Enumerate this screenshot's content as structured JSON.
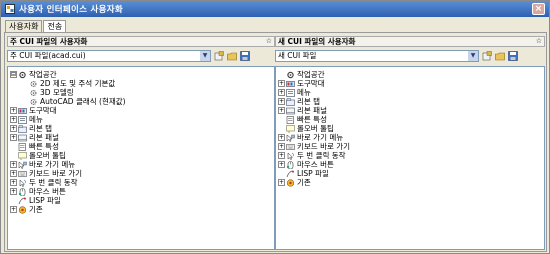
{
  "window": {
    "title": "사용자 인터페이스 사용자화",
    "close_label": "×"
  },
  "tabs": [
    {
      "label": "사용자화"
    },
    {
      "label": "전송"
    }
  ],
  "left_panel": {
    "header": "주 CUI 파일의 사용자화",
    "collapse": "☆",
    "selected_file": "주 CUI 파일(acad.cui)",
    "tree": [
      {
        "label": "작업공간",
        "icon": "workspace-icon",
        "indent": 0,
        "expander": "⊟"
      },
      {
        "label": "2D 제도 및 주석 기본값",
        "icon": "gear-icon",
        "indent": 1,
        "expander": ""
      },
      {
        "label": "3D 모델링",
        "icon": "gear-icon",
        "indent": 1,
        "expander": ""
      },
      {
        "label": "AutoCAD 클래식 (현재값)",
        "icon": "gear-icon",
        "indent": 1,
        "expander": ""
      },
      {
        "label": "도구막대",
        "icon": "toolbar-icon",
        "indent": 0,
        "expander": "+"
      },
      {
        "label": "메뉴",
        "icon": "menu-icon",
        "indent": 0,
        "expander": "+"
      },
      {
        "label": "리본 탭",
        "icon": "ribbon-tab-icon",
        "indent": 0,
        "expander": "+"
      },
      {
        "label": "리본 패널",
        "icon": "ribbon-panel-icon",
        "indent": 0,
        "expander": "+"
      },
      {
        "label": "빠른 특성",
        "icon": "quick-props-icon",
        "indent": 0,
        "expander": ""
      },
      {
        "label": "롤오버 툴팁",
        "icon": "tooltip-icon",
        "indent": 0,
        "expander": ""
      },
      {
        "label": "바로 가기 메뉴",
        "icon": "shortcut-menu-icon",
        "indent": 0,
        "expander": "+"
      },
      {
        "label": "키보드 바로 가기",
        "icon": "keyboard-icon",
        "indent": 0,
        "expander": "+"
      },
      {
        "label": "두 번 클릭 동작",
        "icon": "double-click-icon",
        "indent": 0,
        "expander": "+"
      },
      {
        "label": "마우스 버튼",
        "icon": "mouse-icon",
        "indent": 0,
        "expander": "+"
      },
      {
        "label": "LISP 파일",
        "icon": "lisp-icon",
        "indent": 0,
        "expander": ""
      },
      {
        "label": "기존",
        "icon": "legacy-icon",
        "indent": 0,
        "expander": "+"
      }
    ]
  },
  "right_panel": {
    "header": "새 CUI 파일의 사용자화",
    "collapse": "☆",
    "selected_file": "새 CUI 파일",
    "tree": [
      {
        "label": "작업공간",
        "icon": "workspace-icon",
        "indent": 0,
        "expander": ""
      },
      {
        "label": "도구막대",
        "icon": "toolbar-icon",
        "indent": 0,
        "expander": "+"
      },
      {
        "label": "메뉴",
        "icon": "menu-icon",
        "indent": 0,
        "expander": "+"
      },
      {
        "label": "리본 탭",
        "icon": "ribbon-tab-icon",
        "indent": 0,
        "expander": "+"
      },
      {
        "label": "리본 패널",
        "icon": "ribbon-panel-icon",
        "indent": 0,
        "expander": "+"
      },
      {
        "label": "빠른 특성",
        "icon": "quick-props-icon",
        "indent": 0,
        "expander": ""
      },
      {
        "label": "롤오버 툴팁",
        "icon": "tooltip-icon",
        "indent": 0,
        "expander": ""
      },
      {
        "label": "바로 가기 메뉴",
        "icon": "shortcut-menu-icon",
        "indent": 0,
        "expander": "+"
      },
      {
        "label": "키보드 바로 가기",
        "icon": "keyboard-icon",
        "indent": 0,
        "expander": "+"
      },
      {
        "label": "두 번 클릭 동작",
        "icon": "double-click-icon",
        "indent": 0,
        "expander": "+"
      },
      {
        "label": "마우스 버튼",
        "icon": "mouse-icon",
        "indent": 0,
        "expander": "+"
      },
      {
        "label": "LISP 파일",
        "icon": "lisp-icon",
        "indent": 0,
        "expander": ""
      },
      {
        "label": "기존",
        "icon": "legacy-icon",
        "indent": 0,
        "expander": "+"
      }
    ]
  }
}
